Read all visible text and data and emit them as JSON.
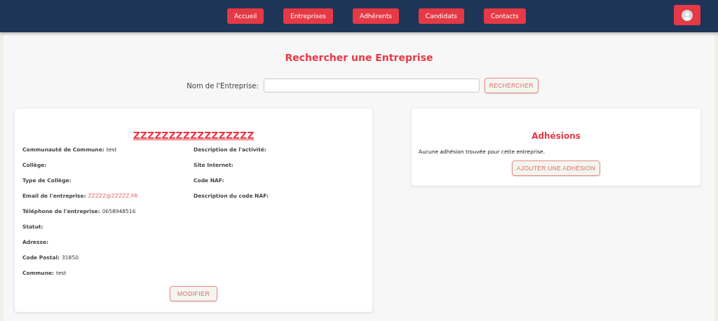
{
  "nav": {
    "items": [
      {
        "label": "Accueil"
      },
      {
        "label": "Entreprises"
      },
      {
        "label": "Adhérents"
      },
      {
        "label": "Candidats"
      },
      {
        "label": "Contacts"
      }
    ]
  },
  "search": {
    "title": "Rechercher une Entreprise",
    "label": "Nom de l'Entreprise:",
    "button": "RECHERCHER"
  },
  "company": {
    "name": "ZZZZZZZZZZZZZZZZZ",
    "left_fields": [
      {
        "label": "Communauté de Commune:",
        "value": "test",
        "kind": "text"
      },
      {
        "label": "Collège:"
      },
      {
        "label": "Type de Collège:"
      },
      {
        "label": "Email de l'entreprise:",
        "value": "ZZZZZ@ZZZZZ.FR",
        "kind": "link"
      },
      {
        "label": "Téléphone de l'entreprise:",
        "value": "0658948516",
        "kind": "text"
      },
      {
        "label": "Statut:"
      },
      {
        "label": "Adresse:"
      },
      {
        "label": "Code Postal:",
        "value": "31850",
        "kind": "text"
      },
      {
        "label": "Commune:",
        "value": "test",
        "kind": "text"
      }
    ],
    "right_fields": [
      {
        "label": "Description de l'activité:"
      },
      {
        "label": "Site Internet:"
      },
      {
        "label": "Code NAF:"
      },
      {
        "label": "Description du code NAF:"
      }
    ],
    "button": "MODIFIER"
  },
  "adhesions": {
    "title": "Adhésions",
    "message": "Aucune adhésion trouvée pour cette entreprise.",
    "button": "AJOUTER UNE ADHÉSION"
  }
}
